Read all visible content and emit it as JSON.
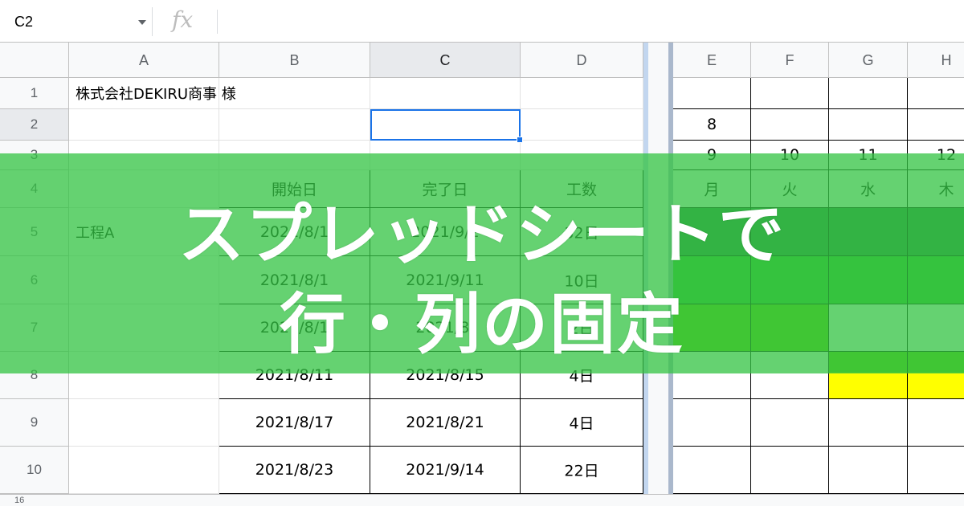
{
  "formula_bar": {
    "name_box_value": "C2",
    "fx_label": "fx",
    "formula_value": ""
  },
  "columns": [
    "A",
    "B",
    "C",
    "D",
    "E",
    "F",
    "G",
    "H"
  ],
  "selected_column": "C",
  "selected_row": "2",
  "rows": [
    {
      "num": "1",
      "cells": {
        "A": "株式会社DEKIRU商事 様",
        "B": "",
        "C": "",
        "D": "",
        "E": "",
        "F": "",
        "G": "",
        "H": ""
      }
    },
    {
      "num": "2",
      "cells": {
        "A": "",
        "B": "",
        "C": "",
        "D": "",
        "E": "8",
        "F": "",
        "G": "",
        "H": ""
      }
    },
    {
      "num": "3",
      "cells": {
        "A": "",
        "B": "",
        "C": "",
        "D": "",
        "E": "9",
        "F": "10",
        "G": "11",
        "H": "12"
      }
    },
    {
      "num": "4",
      "cells": {
        "A": "",
        "B": "開始日",
        "C": "完了日",
        "D": "工数",
        "E": "月",
        "F": "火",
        "G": "水",
        "H": "木"
      }
    },
    {
      "num": "5",
      "cells": {
        "A": "工程A",
        "B": "2021/8/1",
        "C": "2021/9/2",
        "D": "32日",
        "E": "",
        "F": "",
        "G": "",
        "H": ""
      }
    },
    {
      "num": "6",
      "cells": {
        "A": "",
        "B": "2021/8/1",
        "C": "2021/9/11",
        "D": "10日",
        "E": "",
        "F": "",
        "G": "",
        "H": ""
      }
    },
    {
      "num": "7",
      "cells": {
        "A": "",
        "B": "2021/8/1",
        "C": "2021/8/",
        "D": "2日",
        "E": "",
        "F": "",
        "G": "",
        "H": ""
      }
    },
    {
      "num": "8",
      "cells": {
        "A": "",
        "B": "2021/8/11",
        "C": "2021/8/15",
        "D": "4日",
        "E": "",
        "F": "",
        "G": "",
        "H": ""
      }
    },
    {
      "num": "9",
      "cells": {
        "A": "",
        "B": "2021/8/17",
        "C": "2021/8/21",
        "D": "4日",
        "E": "",
        "F": "",
        "G": "",
        "H": ""
      }
    },
    {
      "num": "10",
      "cells": {
        "A": "",
        "B": "2021/8/23",
        "C": "2021/9/14",
        "D": "22日",
        "E": "",
        "F": "",
        "G": "",
        "H": ""
      }
    }
  ],
  "gantt_colors": {
    "row5": "#2e7d46",
    "row6": "#38c02c",
    "row7": "#66cc00",
    "row8_G": "#66cc00",
    "row8_yellow": "#ffff00"
  },
  "bottom_strip_label": "16",
  "banner": {
    "line1": "スプレッドシートで",
    "line2": "行・列の固定",
    "color": "#34c444"
  }
}
